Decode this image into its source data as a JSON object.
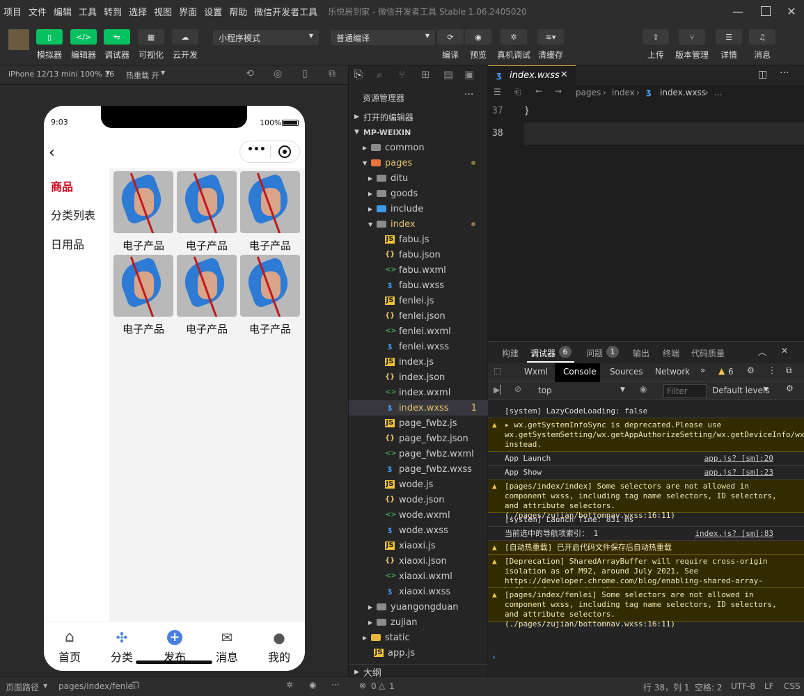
{
  "menu": [
    "项目",
    "文件",
    "编辑",
    "工具",
    "转到",
    "选择",
    "视图",
    "界面",
    "设置",
    "帮助",
    "微信开发者工具"
  ],
  "window_title": "乐悦居到家 - 微信开发者工具 Stable 1.06.2405020",
  "toolbar": {
    "simulator": "模拟器",
    "editor": "编辑器",
    "debugger": "调试器",
    "visual": "可视化",
    "cloud": "云开发",
    "mode": "小程序模式",
    "compile_mode": "普通编译",
    "compile": "编译",
    "preview": "预览",
    "real_debug": "真机调试",
    "clear_cache": "清缓存",
    "upload": "上传",
    "version": "版本管理",
    "details": "详情",
    "messages": "消息"
  },
  "simbar": {
    "device": "iPhone 12/13 mini 100% 16",
    "hot_reload": "热重载 开"
  },
  "phone": {
    "time": "9:03",
    "battery": "100%",
    "categories": [
      "商品",
      "分类列表",
      "日用品"
    ],
    "products": [
      "电子产品",
      "电子产品",
      "电子产品",
      "电子产品",
      "电子产品",
      "电子产品"
    ],
    "tabs": [
      "首页",
      "分类",
      "发布",
      "消息",
      "我的"
    ]
  },
  "explorer": {
    "title": "资源管理器",
    "open_editors": "打开的编辑器",
    "project": "MP-WEIXIN",
    "items": [
      "common",
      "pages",
      "ditu",
      "goods",
      "include",
      "index",
      "fabu.js",
      "fabu.json",
      "fabu.wxml",
      "fabu.wxss",
      "fenlei.js",
      "fenlei.json",
      "fenlei.wxml",
      "fenlei.wxss",
      "index.js",
      "index.json",
      "index.wxml",
      "index.wxss",
      "page_fwbz.js",
      "page_fwbz.json",
      "page_fwbz.wxml",
      "page_fwbz.wxss",
      "wode.js",
      "wode.json",
      "wode.wxml",
      "wode.wxss",
      "xiaoxi.js",
      "xiaoxi.json",
      "xiaoxi.wxml",
      "xiaoxi.wxss",
      "yuangongduan",
      "zujian",
      "static",
      "app.js"
    ],
    "badge": "1",
    "outline": "大纲"
  },
  "editor": {
    "tab": "index.wxss",
    "breadcrumb": [
      "pages",
      "index",
      "index.wxss",
      "..."
    ],
    "lines": [
      {
        "num": "37",
        "text": "}"
      },
      {
        "num": "38",
        "text": ""
      }
    ]
  },
  "devtools": {
    "top_tabs": [
      "构建",
      "调试器",
      "问题",
      "输出",
      "终端",
      "代码质量"
    ],
    "debugger_badge": "6",
    "issues_badge": "1",
    "panel_tabs": [
      "Wxml",
      "Console",
      "Sources",
      "Network"
    ],
    "warn_count": "6",
    "context": "top",
    "filter_placeholder": "Filter",
    "levels": "Default levels",
    "logs": [
      {
        "t": "[system] LazyCodeLoading: false",
        "warn": false,
        "src": ""
      },
      {
        "t": "▸ wx.getSystemInfoSync is deprecated.Please use wx.getSystemSetting/wx.getAppAuthorizeSetting/wx.getDeviceInfo/wx.getWindowInfo/wx.getAppBaseInfo instead.",
        "warn": true,
        "src": ""
      },
      {
        "t": "App Launch",
        "warn": false,
        "src": "app.js? [sm]:20"
      },
      {
        "t": "App Show",
        "warn": false,
        "src": "app.js? [sm]:23"
      },
      {
        "t": "[pages/index/index] Some selectors are not allowed in component wxss, including tag name selectors, ID selectors, and attribute selectors.(./pages/zujian/bottomnav.wxss:16:11)",
        "warn": true,
        "src": ""
      },
      {
        "t": "[system] Launch Time: 831 ms",
        "warn": false,
        "src": ""
      },
      {
        "t": "当前选中的导航项索引： 1",
        "warn": false,
        "src": "index.js? [sm]:83"
      },
      {
        "t": "[自动热重载] 已开启代码文件保存后自动热重载",
        "warn": true,
        "src": ""
      },
      {
        "t": "[Deprecation] SharedArrayBuffer will require cross-origin isolation as of M92, around July 2021. See https://developer.chrome.com/blog/enabling-shared-array-buffer/ for more details.",
        "warn": true,
        "src": ""
      },
      {
        "t": "[pages/index/fenlei] Some selectors are not allowed in component wxss, including tag name selectors, ID selectors, and attribute selectors.(./pages/zujian/bottomnav.wxss:16:11)",
        "warn": true,
        "src": ""
      }
    ]
  },
  "status": {
    "page_path_label": "页面路径",
    "page_path": "pages/index/fenlei",
    "errors": "0",
    "warnings": "1",
    "position": "行 38，列 1",
    "spaces": "空格: 2",
    "encoding": "UTF-8",
    "eol": "LF",
    "lang": "CSS"
  }
}
